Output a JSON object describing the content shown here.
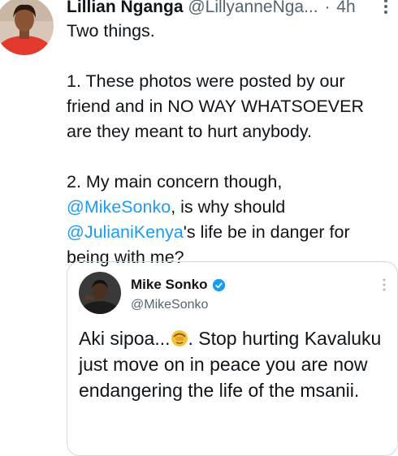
{
  "tweet": {
    "author_name": "Lillian Nganga",
    "author_handle": "@LillyanneNga...",
    "separator": "·",
    "time": "4h",
    "avatar_icon": "user-avatar-photo",
    "more_icon": "more-vertical-icon",
    "paragraphs": {
      "p1": "Two things.",
      "p2": "1. These photos were posted by our friend and in NO WAY WHATSOEVER are they meant to hurt anybody.",
      "p3_a": "2. My main concern though, ",
      "p3_mention1": "@MikeSonko",
      "p3_b": ", is why should ",
      "p3_mention2": "@JulianiKenya",
      "p3_c": "'s life be in danger for being with me?"
    }
  },
  "quoted_tweet": {
    "author_name": "Mike Sonko",
    "author_handle": "@MikeSonko",
    "verified_icon": "verified-badge-icon",
    "text_a": "Aki sipoa...",
    "emoji_icon": "person-facepalming-emoji",
    "text_b": ". Stop hurting Kavaluku just move on in peace you are now endangering the life of the msanii."
  },
  "colors": {
    "link": "#1d9bf0",
    "text": "#0f1419",
    "secondary_text": "#536471",
    "border": "#cfd9de"
  }
}
